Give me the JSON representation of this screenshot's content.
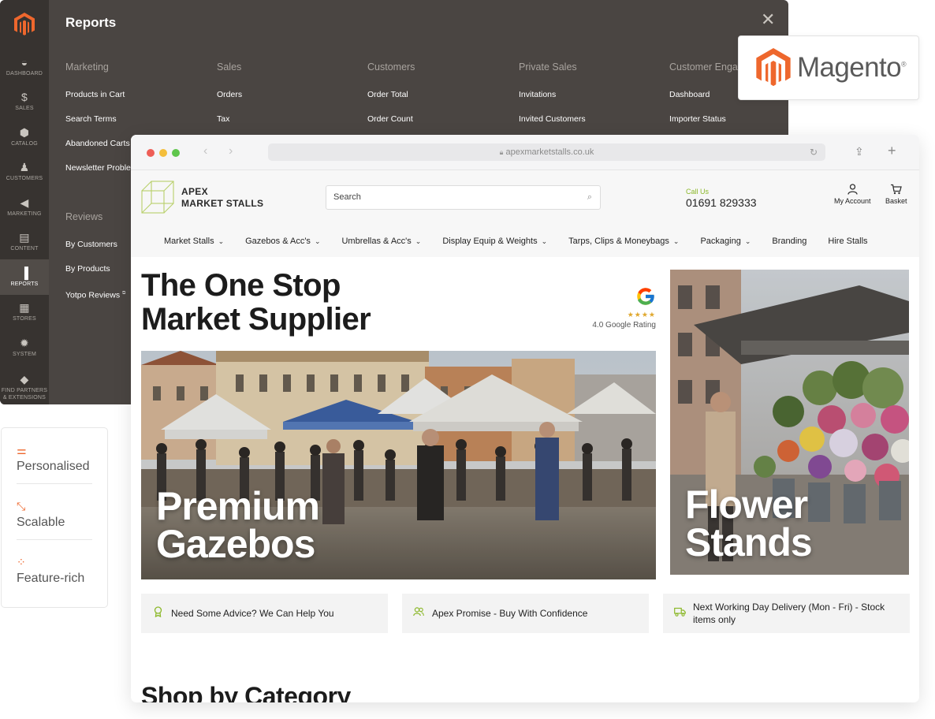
{
  "admin": {
    "title": "Reports",
    "close_icon": "close-icon",
    "rail": [
      {
        "label": "DASHBOARD",
        "icon": "dashboard-icon",
        "glyph": "◒"
      },
      {
        "label": "SALES",
        "icon": "dollar-icon",
        "glyph": "$"
      },
      {
        "label": "CATALOG",
        "icon": "cube-icon",
        "glyph": "⬢"
      },
      {
        "label": "CUSTOMERS",
        "icon": "person-icon",
        "glyph": "♟"
      },
      {
        "label": "MARKETING",
        "icon": "megaphone-icon",
        "glyph": "◀"
      },
      {
        "label": "CONTENT",
        "icon": "layout-icon",
        "glyph": "▤"
      },
      {
        "label": "REPORTS",
        "icon": "bar-chart-icon",
        "glyph": "▐"
      },
      {
        "label": "STORES",
        "icon": "store-icon",
        "glyph": "▦"
      },
      {
        "label": "SYSTEM",
        "icon": "gear-icon",
        "glyph": "✹"
      },
      {
        "label_1": "FIND PARTNERS",
        "label_2": "& EXTENSIONS",
        "icon": "box-icon",
        "glyph": "◆"
      }
    ],
    "columns": [
      {
        "heading": "Marketing",
        "links": [
          "Products in Cart",
          "Search Terms",
          "Abandoned Carts",
          "Newsletter Problem Reports"
        ],
        "heading2": "Reviews",
        "links2": [
          "By Customers",
          "By Products",
          "Yotpo Reviews"
        ]
      },
      {
        "heading": "Sales",
        "links": [
          "Orders",
          "Tax"
        ]
      },
      {
        "heading": "Customers",
        "links": [
          "Order Total",
          "Order Count"
        ]
      },
      {
        "heading": "Private Sales",
        "links": [
          "Invitations",
          "Invited Customers"
        ]
      },
      {
        "heading": "Customer Engagement",
        "links": [
          "Dashboard",
          "Importer Status"
        ]
      }
    ]
  },
  "magento_card": {
    "wordmark": "Magento",
    "reg": "®"
  },
  "features": [
    {
      "label": "Personalised",
      "icon": "sliders-icon",
      "glyph": "⚌"
    },
    {
      "label": "Scalable",
      "icon": "expand-arrows-icon",
      "glyph": "⤡"
    },
    {
      "label": "Feature-rich",
      "icon": "grid-circles-icon",
      "glyph": "⁘"
    }
  ],
  "browser": {
    "url": "apexmarketstalls.co.uk",
    "colors": {
      "close": "#ee5e56",
      "minimize": "#f4be3b",
      "maximize": "#5fc64c"
    }
  },
  "site": {
    "logo_line1": "APEX",
    "logo_line2": "MARKET STALLS",
    "search_placeholder": "Search",
    "call_us": "Call Us",
    "phone": "01691 829333",
    "my_account": "My Account",
    "basket": "Basket",
    "nav": [
      {
        "label": "Market Stalls",
        "dropdown": true
      },
      {
        "label": "Gazebos & Acc's",
        "dropdown": true
      },
      {
        "label": "Umbrellas & Acc's",
        "dropdown": true
      },
      {
        "label": "Display Equip & Weights",
        "dropdown": true
      },
      {
        "label": "Tarps, Clips & Moneybags",
        "dropdown": true
      },
      {
        "label": "Packaging",
        "dropdown": true
      },
      {
        "label": "Branding",
        "dropdown": false
      },
      {
        "label": "Hire Stalls",
        "dropdown": false
      }
    ],
    "hero_line1": "The One Stop",
    "hero_line2": "Market Supplier",
    "google_stars": 4,
    "google_rating_text": "4.0 Google Rating",
    "banner_a_line1": "Premium",
    "banner_a_line2": "Gazebos",
    "banner_b_line1": "Flower",
    "banner_b_line2": "Stands",
    "info": [
      {
        "text": "Need Some Advice? We Can Help You",
        "icon": "award-icon"
      },
      {
        "text": "Apex Promise - Buy With Confidence",
        "icon": "users-icon"
      },
      {
        "text": "Next Working Day Delivery (Mon - Fri) - Stock items only",
        "icon": "truck-icon"
      }
    ],
    "shop_title": "Shop by Category",
    "accent": "#8bb829"
  }
}
